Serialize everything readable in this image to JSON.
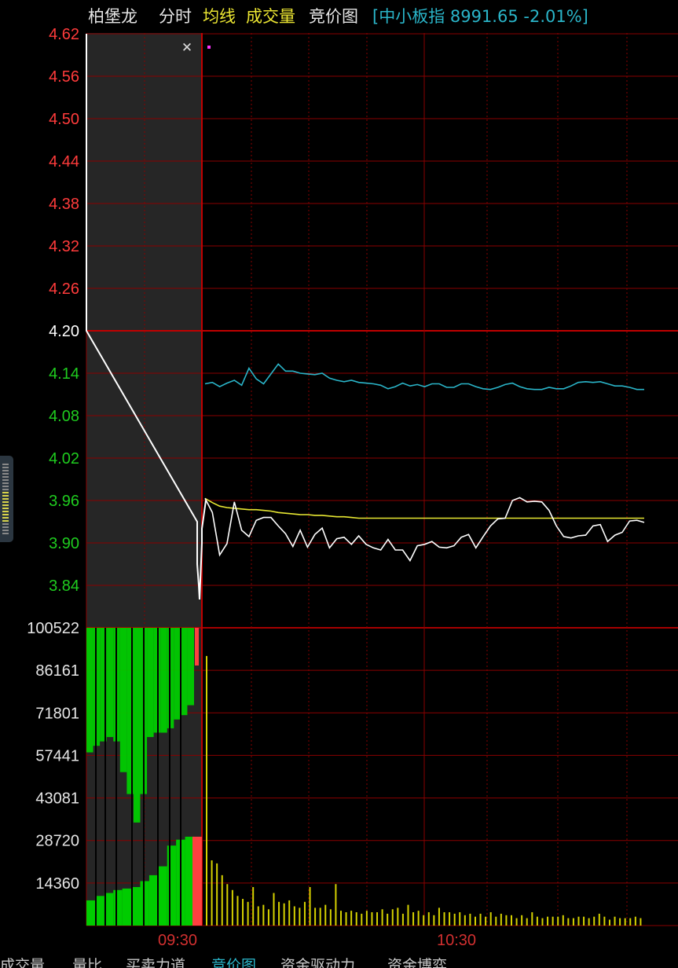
{
  "header": {
    "stock_name": "柏堡龙",
    "tab_intraday": "分时",
    "toggle_avg": "均线",
    "toggle_volume": "成交量",
    "tab_auction": "竞价图",
    "index_info": "[中小板指 8991.65 -2.01%]"
  },
  "colors": {
    "background": "#000000",
    "grid": "#8a0000",
    "grid_bold": "#c00000",
    "price_up": "#ff3b3b",
    "price_base": "#ffffff",
    "price_down": "#1fcc1f",
    "avg_line": "#e8e832",
    "index_line": "#2ab5c9",
    "price_line": "#ffffff",
    "vol_sell": "#00cc00",
    "vol_buy": "#ff4040",
    "vol_bar": "#d6d200",
    "auction_panel": "#262626"
  },
  "chart_data": {
    "type": "line",
    "price_axis": {
      "ticks": [
        "4.62",
        "4.56",
        "4.50",
        "4.44",
        "4.38",
        "4.32",
        "4.26",
        "4.20",
        "4.14",
        "4.08",
        "4.02",
        "3.96",
        "3.90",
        "3.84"
      ],
      "range": [
        3.84,
        4.62
      ],
      "base": 4.2
    },
    "volume_axis": {
      "ticks": [
        "100522",
        "86161",
        "71801",
        "57441",
        "43081",
        "28720",
        "14360"
      ],
      "range": [
        0,
        100522
      ]
    },
    "time_labels": [
      "09:30",
      "10:30"
    ],
    "auction": {
      "price": [
        4.2,
        4.2,
        4.2,
        4.2,
        3.93,
        3.87,
        3.84,
        3.82,
        3.9,
        3.92,
        3.96
      ],
      "sell_imbalance": [
        79000,
        82000,
        84000,
        86000,
        84000,
        70000,
        60000,
        47000,
        60000,
        86000,
        88000,
        88000,
        90000,
        94000,
        96000,
        100522
      ],
      "matched_volume": [
        8500,
        10000,
        11000,
        12000,
        12500,
        13000,
        15000,
        17000,
        20000,
        27000,
        29000,
        30000
      ]
    },
    "series": [
      {
        "key": "index",
        "values": [
          4.125,
          4.127,
          4.121,
          4.126,
          4.13,
          4.123,
          4.147,
          4.132,
          4.125,
          4.139,
          4.153,
          4.143,
          4.143,
          4.14,
          4.139,
          4.138,
          4.14,
          4.133,
          4.13,
          4.128,
          4.13,
          4.127,
          4.126,
          4.125,
          4.123,
          4.118,
          4.121,
          4.126,
          4.122,
          4.124,
          4.121,
          4.125,
          4.125,
          4.12,
          4.12,
          4.125,
          4.125,
          4.121,
          4.118,
          4.117,
          4.12,
          4.124,
          4.126,
          4.121,
          4.118,
          4.117,
          4.117,
          4.12,
          4.118,
          4.118,
          4.122,
          4.127,
          4.128,
          4.127,
          4.128,
          4.125,
          4.122,
          4.122,
          4.12,
          4.117,
          4.117
        ]
      },
      {
        "key": "avg",
        "values": [
          3.963,
          3.957,
          3.952,
          3.95,
          3.949,
          3.948,
          3.947,
          3.947,
          3.946,
          3.945,
          3.943,
          3.942,
          3.941,
          3.94,
          3.94,
          3.939,
          3.939,
          3.938,
          3.937,
          3.937,
          3.936,
          3.935,
          3.935,
          3.935,
          3.935,
          3.935,
          3.935,
          3.935,
          3.935,
          3.935,
          3.935,
          3.935,
          3.935,
          3.935,
          3.935,
          3.935,
          3.935,
          3.935,
          3.935,
          3.935,
          3.935,
          3.935,
          3.935,
          3.935,
          3.935,
          3.935,
          3.935,
          3.935,
          3.935,
          3.935,
          3.935,
          3.935,
          3.935,
          3.935,
          3.935,
          3.935,
          3.935,
          3.935,
          3.935,
          3.935,
          3.935
        ]
      },
      {
        "key": "price",
        "values": [
          3.963,
          3.943,
          3.883,
          3.899,
          3.958,
          3.918,
          3.909,
          3.932,
          3.936,
          3.936,
          3.924,
          3.913,
          3.895,
          3.918,
          3.894,
          3.912,
          3.921,
          3.893,
          3.906,
          3.908,
          3.898,
          3.91,
          3.898,
          3.893,
          3.89,
          3.905,
          3.89,
          3.89,
          3.875,
          3.896,
          3.898,
          3.902,
          3.894,
          3.893,
          3.896,
          3.908,
          3.912,
          3.893,
          3.909,
          3.924,
          3.934,
          3.935,
          3.96,
          3.964,
          3.958,
          3.959,
          3.958,
          3.946,
          3.924,
          3.909,
          3.907,
          3.91,
          3.911,
          3.924,
          3.926,
          3.902,
          3.911,
          3.915,
          3.931,
          3.932,
          3.929
        ]
      }
    ],
    "volume_bars": [
      91000,
      22000,
      21000,
      17000,
      14000,
      12000,
      10000,
      9000,
      8000,
      13000,
      6500,
      7000,
      5500,
      11000,
      8000,
      7500,
      8500,
      6500,
      6000,
      8000,
      13000,
      6000,
      6000,
      7000,
      5500,
      14000,
      5000,
      4500,
      5000,
      4500,
      4000,
      5000,
      4500,
      4500,
      5500,
      4000,
      5500,
      6000,
      4000,
      7000,
      4500,
      5000,
      3500,
      4500,
      3500,
      6000,
      4500,
      4500,
      4000,
      4500,
      3500,
      4000,
      3000,
      4000,
      3000,
      4500,
      3000,
      4000,
      3500,
      3500,
      2500,
      3500,
      2500,
      4500,
      3000,
      2500,
      3000,
      3000,
      3000,
      3500,
      2500,
      2500,
      3000,
      3000,
      2500,
      3000,
      4000,
      3000,
      2000,
      3000,
      2500,
      2500,
      2500,
      3000,
      2500
    ]
  },
  "bottom_tabs": [
    {
      "label": "成交量",
      "active": false
    },
    {
      "label": "量比",
      "active": false
    },
    {
      "label": "买卖力道",
      "active": false
    },
    {
      "label": "竞价图",
      "active": true
    },
    {
      "label": "资金驱动力",
      "active": false
    },
    {
      "label": "资金博弈",
      "active": false
    }
  ]
}
